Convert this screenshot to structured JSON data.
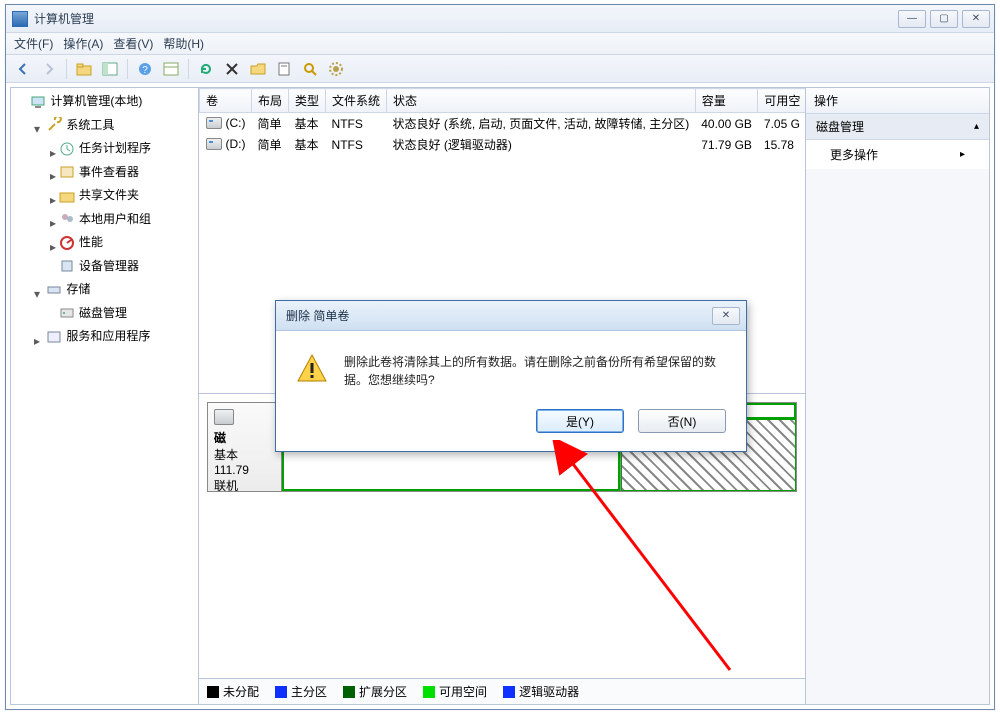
{
  "window": {
    "title": "计算机管理"
  },
  "menu": {
    "file": "文件(F)",
    "action": "操作(A)",
    "view": "查看(V)",
    "help": "帮助(H)"
  },
  "tree": {
    "root": "计算机管理(本地)",
    "system_tools": "系统工具",
    "task_scheduler": "任务计划程序",
    "event_viewer": "事件查看器",
    "shared_folders": "共享文件夹",
    "local_users": "本地用户和组",
    "performance": "性能",
    "device_manager": "设备管理器",
    "storage": "存储",
    "disk_management": "磁盘管理",
    "services_apps": "服务和应用程序"
  },
  "columns": {
    "volume": "卷",
    "layout": "布局",
    "type": "类型",
    "fs": "文件系统",
    "status": "状态",
    "capacity": "容量",
    "free": "可用空"
  },
  "rows": [
    {
      "vol": "(C:)",
      "layout": "简单",
      "type": "基本",
      "fs": "NTFS",
      "status": "状态良好 (系统, 启动, 页面文件, 活动, 故障转储, 主分区)",
      "capacity": "40.00 GB",
      "free": "7.05 G"
    },
    {
      "vol": "(D:)",
      "layout": "简单",
      "type": "基本",
      "fs": "NTFS",
      "status": "状态良好 (逻辑驱动器)",
      "capacity": "71.79 GB",
      "free": "15.78"
    }
  ],
  "disk": {
    "label_line1": "磁",
    "label_line2": "基本",
    "label_line3": "111.79",
    "label_line4": "联机"
  },
  "legend": {
    "unallocated": "未分配",
    "primary": "主分区",
    "extended": "扩展分区",
    "free": "可用空间",
    "logical": "逻辑驱动器"
  },
  "actions": {
    "header": "操作",
    "section": "磁盘管理",
    "more": "更多操作"
  },
  "dialog": {
    "title": "删除 简单卷",
    "message": "删除此卷将清除其上的所有数据。请在删除之前备份所有希望保留的数据。您想继续吗?",
    "yes": "是(Y)",
    "no": "否(N)"
  }
}
